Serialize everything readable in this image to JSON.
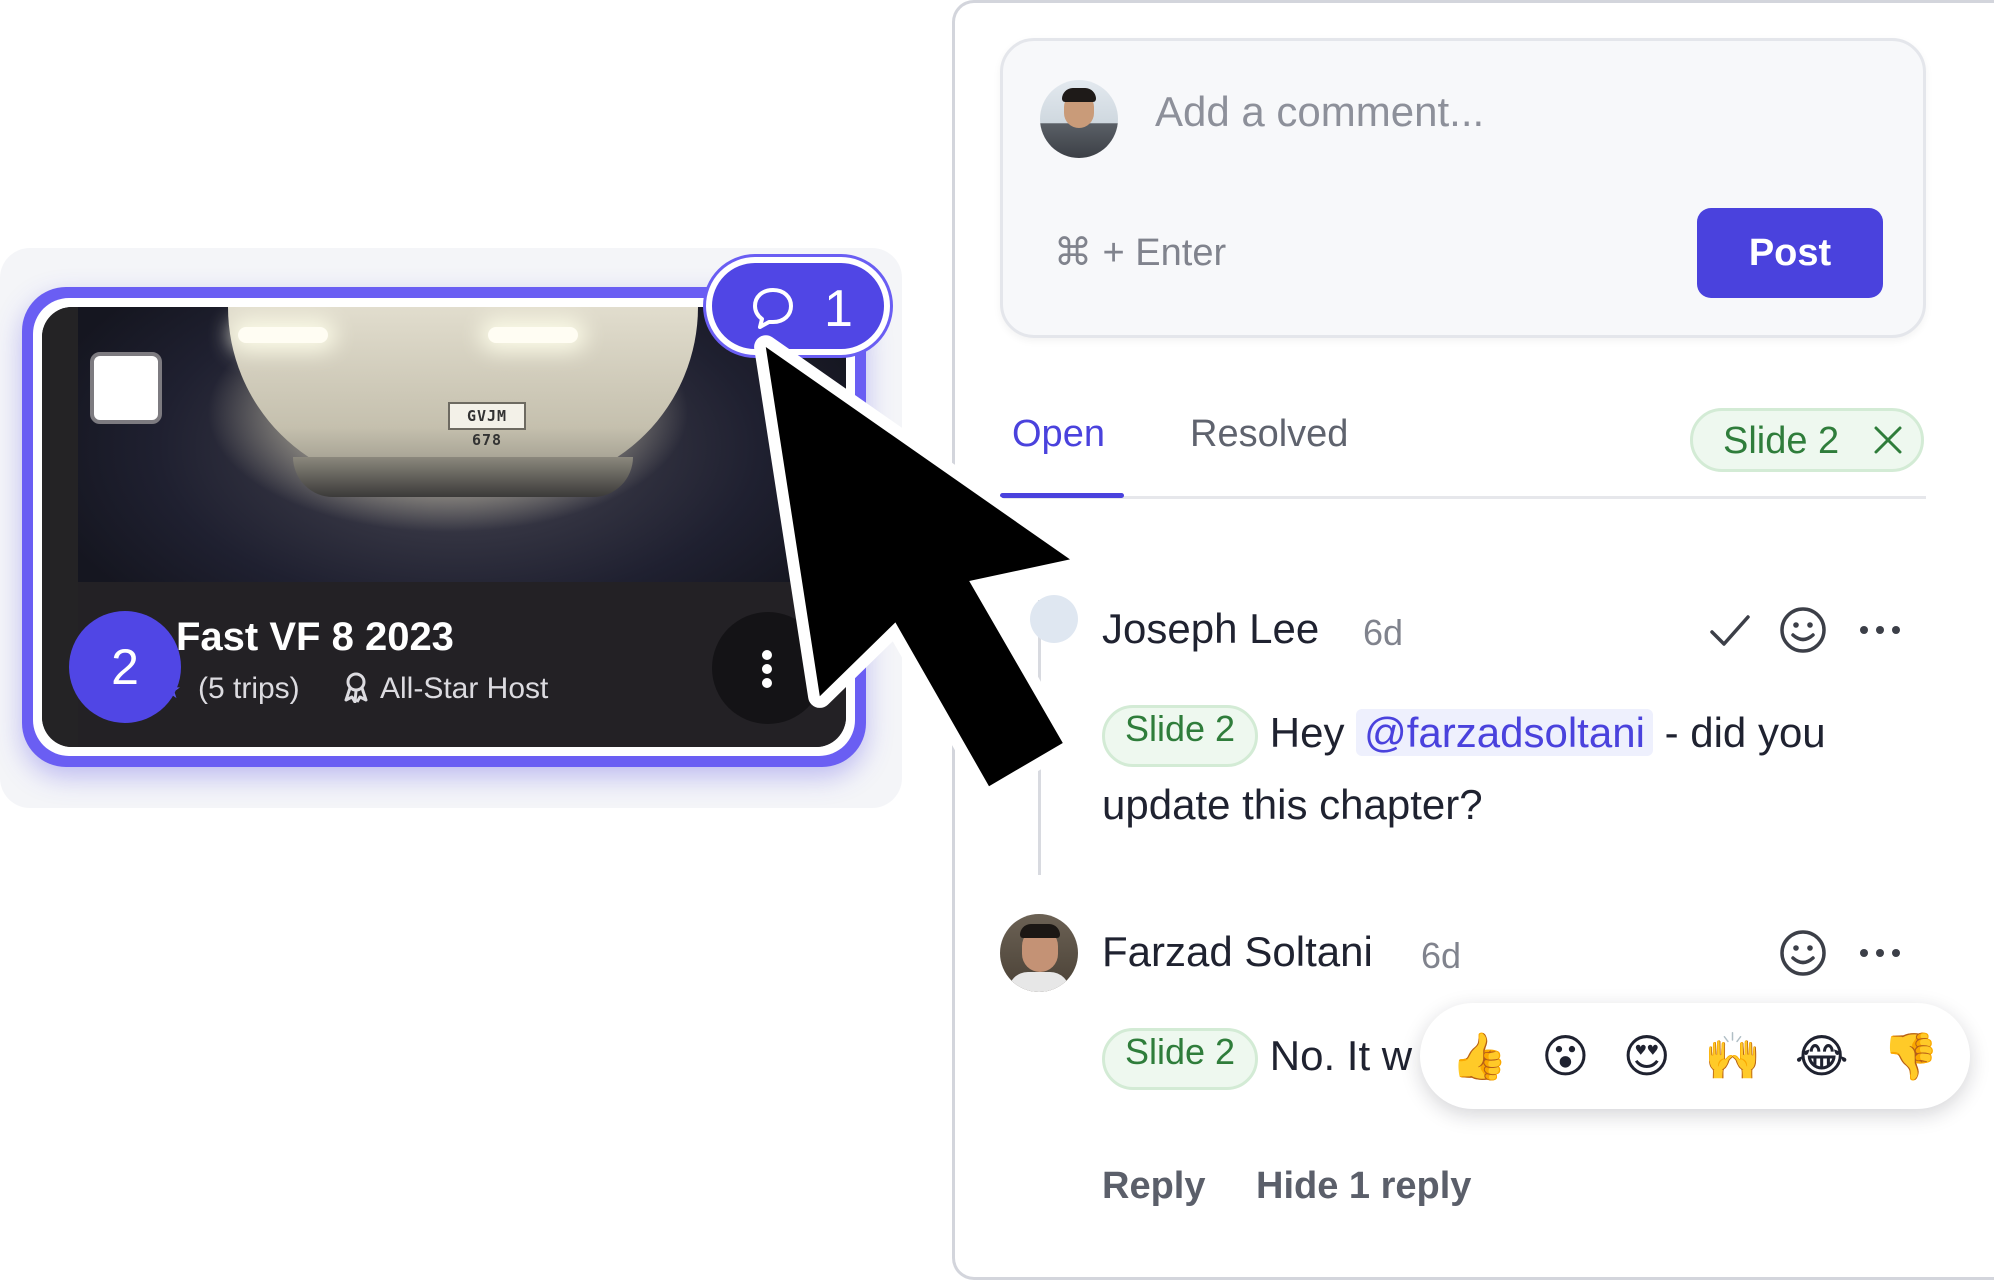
{
  "slide_card": {
    "title": "Fast VF 8 2023",
    "trips": "(5 trips)",
    "host_badge": "All-Star Host",
    "plate_text": "GVJM 678",
    "slide_number": "2",
    "comment_count": "1",
    "icons": [
      "star-icon",
      "host-badge-icon",
      "checkbox-icon",
      "more-vertical-icon",
      "comment-bubble-icon"
    ]
  },
  "composer": {
    "placeholder": "Add a comment...",
    "shortcut": "⌘ + Enter",
    "post_label": "Post"
  },
  "tabs": {
    "open": "Open",
    "resolved": "Resolved",
    "active": "Open",
    "filter_chip": "Slide 2"
  },
  "comments": [
    {
      "author": "Joseph Lee",
      "time": "6d",
      "tag": "Slide 2",
      "text_before": "Hey",
      "mention": "@farzadsoltani",
      "text_after": "- did you update this chapter?",
      "actions": [
        "check-icon",
        "emoji-icon",
        "more-icon"
      ]
    },
    {
      "author": "Farzad Soltani",
      "time": "6d",
      "tag": "Slide 2",
      "text": "No. It w",
      "actions": [
        "emoji-icon",
        "more-icon"
      ]
    }
  ],
  "thread_actions": {
    "reply": "Reply",
    "hide_replies": "Hide 1 reply"
  },
  "reactions": [
    "👍",
    "😮",
    "😍",
    "🙌",
    "😂",
    "👎"
  ],
  "colors": {
    "accent": "#4a42dd",
    "tag_green": "#2f7d3b",
    "tag_bg": "#eef8ef"
  }
}
